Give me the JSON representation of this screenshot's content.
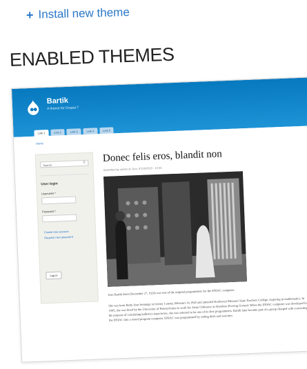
{
  "install_link": {
    "icon": "plus-icon",
    "label": "Install new theme"
  },
  "section_title": "ENABLED THEMES",
  "theme_preview": {
    "site_name": "Bartik",
    "site_slogan": "A theme for Drupal 7",
    "tabs": [
      "Link 1",
      "Link 2",
      "Link 3",
      "Link 4",
      "Link 5"
    ],
    "breadcrumb": "Home",
    "sidebar": {
      "search_placeholder": "Search",
      "login_title": "User login",
      "username_label": "Username *",
      "password_label": "Password *",
      "links": [
        "Create new account",
        "Request new password"
      ],
      "login_button": "Log in"
    },
    "article": {
      "title": "Donec felis eros, blandit non",
      "submitted": "Submitted by admin on Sun, 07/18/2010 - 10:35",
      "paragraphs": [
        "Jean Bartik (born December 27, 1924) was one of the original programmers for the ENIAC computer.",
        "She was born Betty Jean Jennings in Gentry County, Missouri. In 1945 and attended Northwest Missouri State Teachers College, majoring in mathematics. In 1945, she was hired by the University of Pennsylvania to work for Army Ordnance at Aberdeen Proving Ground. When the ENIAC computer was developed for the purpose of calculating ballistics trajectories, she was selected to be one of its first programmers. Bartik later became part of a group charged with converting the ENIAC into a stored program computer. ENIAC was programmed by setting dials and switches."
      ]
    }
  }
}
